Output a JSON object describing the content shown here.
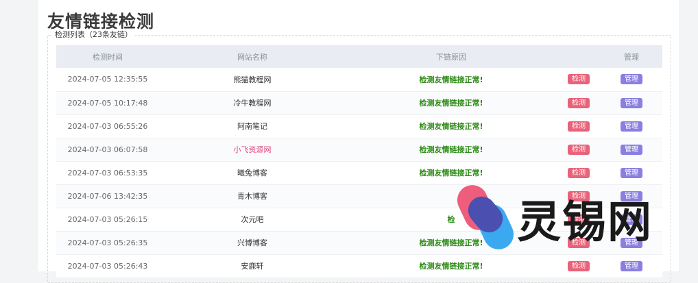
{
  "page": {
    "title": "友情链接检测",
    "list_title": "检测列表（23条友链）"
  },
  "table": {
    "headers": [
      "检测时间",
      "网站名称",
      "下链原因",
      "管理"
    ],
    "check_label": "检测",
    "manage_label": "管理",
    "rows": [
      {
        "time": "2024-07-05 12:35:55",
        "site": "熊猫教程网",
        "status": "检测友情链接正常!"
      },
      {
        "time": "2024-07-05 10:17:48",
        "site": "冷牛教程网",
        "status": "检测友情链接正常!"
      },
      {
        "time": "2024-07-03 06:55:26",
        "site": "阿南笔记",
        "status": "检测友情链接正常!"
      },
      {
        "time": "2024-07-03 06:07:58",
        "site": "小飞资源网",
        "status": "检测友情链接正常!",
        "highlight": true
      },
      {
        "time": "2024-07-03 06:53:35",
        "site": "曦兔博客",
        "status": "检测友情链接正常!"
      },
      {
        "time": "2024-07-06 13:42:35",
        "site": "青木博客",
        "status": ""
      },
      {
        "time": "2024-07-03 05:26:15",
        "site": "次元吧",
        "status": "检"
      },
      {
        "time": "2024-07-03 05:26:35",
        "site": "兴博博客",
        "status": "检测友情链接正常!"
      },
      {
        "time": "2024-07-03 05:26:43",
        "site": "安鹿轩",
        "status": "检测友情链接正常!"
      }
    ]
  },
  "watermark": {
    "text": "灵锡网",
    "colors": {
      "pink": "#ef5d7c",
      "blue": "#3aa9f0",
      "indigo": "#4a4fb0"
    }
  },
  "colors": {
    "status_ok": "#2e8b17",
    "check_button": "#e8637a",
    "manage_button": "#8a7fe0",
    "highlight_site": "#e0457b"
  }
}
